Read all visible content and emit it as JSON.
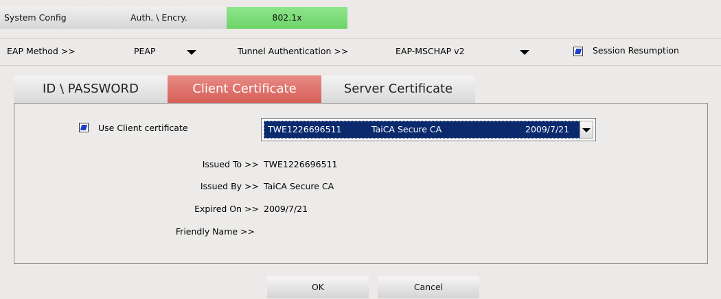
{
  "top_tabs": {
    "system_config": "System Config",
    "auth_encry": "Auth. \\ Encry.",
    "dot1x": "802.1x"
  },
  "eap_row": {
    "eap_method_label": "EAP Method >>",
    "eap_method_value": "PEAP",
    "tunnel_auth_label": "Tunnel Authentication >>",
    "tunnel_auth_value": "EAP-MSCHAP v2",
    "session_resumption_label": "Session Resumption"
  },
  "sub_tabs": {
    "id_password": "ID \\ PASSWORD",
    "client_certificate": "Client Certificate",
    "server_certificate": "Server Certificate"
  },
  "client_cert": {
    "use_client_cert_label": "Use Client certificate",
    "selected": {
      "issued_to": "TWE1226696511",
      "issued_by": "TaiCA Secure CA",
      "expired_on": "2009/7/21"
    },
    "issued_to_label": "Issued To >>",
    "issued_to_value": "TWE1226696511",
    "issued_by_label": "Issued By >>",
    "issued_by_value": "TaiCA Secure CA",
    "expired_on_label": "Expired On >>",
    "expired_on_value": "2009/7/21",
    "friendly_name_label": "Friendly Name >>",
    "friendly_name_value": ""
  },
  "buttons": {
    "ok": "OK",
    "cancel": "Cancel"
  },
  "colors": {
    "active_top_tab": "#76d972",
    "active_sub_tab": "#df716b",
    "selection": "#0b2a6e",
    "checkbox": "#1a3fd1"
  }
}
